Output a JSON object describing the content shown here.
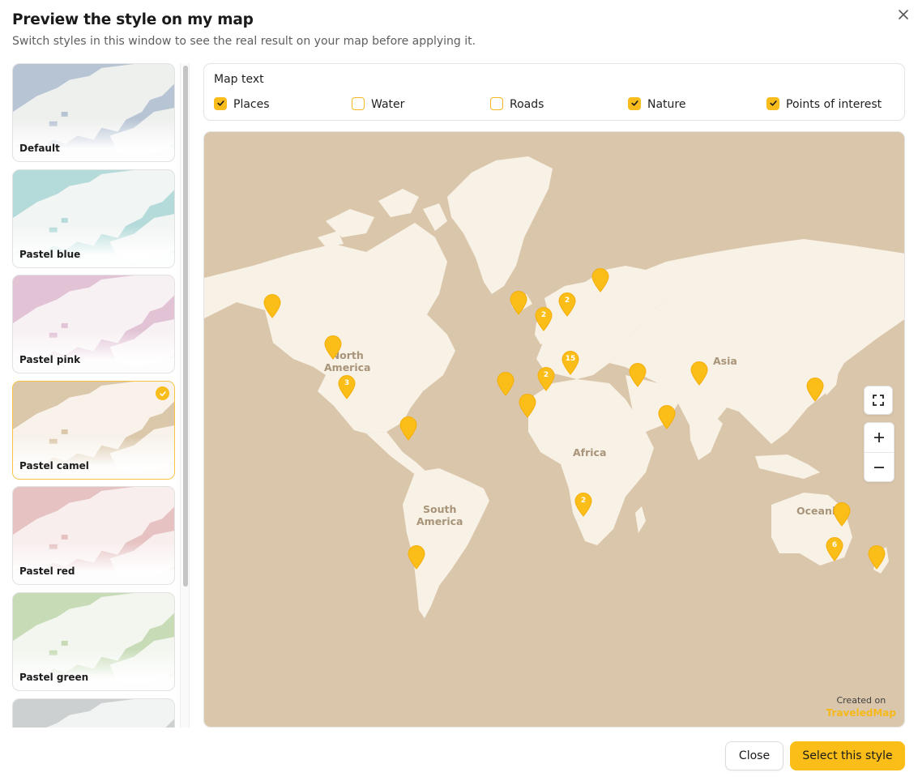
{
  "dialog": {
    "title": "Preview the style on my map",
    "subtitle": "Switch styles in this window to see the real result on your map before applying it.",
    "close_icon": "close-icon"
  },
  "styles": [
    {
      "label": "Default",
      "water": "#b7c4d4",
      "land": "#eef0ee",
      "selected": false
    },
    {
      "label": "Pastel blue",
      "water": "#b4dbd9",
      "land": "#f1f5f3",
      "selected": false
    },
    {
      "label": "Pastel pink",
      "water": "#e2c3d6",
      "land": "#f8f1f4",
      "selected": false
    },
    {
      "label": "Pastel camel",
      "water": "#dbc8ab",
      "land": "#f8f2ea",
      "selected": true
    },
    {
      "label": "Pastel red",
      "water": "#e6c3c2",
      "land": "#f9eeee",
      "selected": false
    },
    {
      "label": "Pastel green",
      "water": "#c6dbb6",
      "land": "#f2f6ee",
      "selected": false
    },
    {
      "label": "",
      "water": "#ccd0d0",
      "land": "#f2f3f3",
      "selected": false
    }
  ],
  "map_text": {
    "title": "Map text",
    "options": [
      {
        "label": "Places",
        "checked": true
      },
      {
        "label": "Water",
        "checked": false
      },
      {
        "label": "Roads",
        "checked": false
      },
      {
        "label": "Nature",
        "checked": true
      },
      {
        "label": "Points of interest",
        "checked": true
      }
    ]
  },
  "map": {
    "water_color": "#dac7ab",
    "land_color": "#f8f1e6",
    "pin_color": "#fbbd17",
    "labels": {
      "north_america": "North\nAmerica",
      "south_america": "South\nAmerica",
      "africa": "Africa",
      "asia": "Asia",
      "oceania": "Oceania"
    },
    "pins": [
      {
        "count": ""
      },
      {
        "count": ""
      },
      {
        "count": "3"
      },
      {
        "count": ""
      },
      {
        "count": "2"
      },
      {
        "count": ""
      },
      {
        "count": "2"
      },
      {
        "count": ""
      },
      {
        "count": ""
      },
      {
        "count": "15"
      },
      {
        "count": "2"
      },
      {
        "count": ""
      },
      {
        "count": ""
      },
      {
        "count": ""
      },
      {
        "count": ""
      },
      {
        "count": ""
      },
      {
        "count": ""
      },
      {
        "count": "2"
      },
      {
        "count": ""
      },
      {
        "count": "6"
      },
      {
        "count": ""
      }
    ],
    "controls": {
      "fullscreen_icon": "fullscreen-icon",
      "zoom_in": "+",
      "zoom_out": "−"
    },
    "credit": {
      "text": "Created on",
      "brand": "TraveledMap"
    }
  },
  "footer": {
    "close_label": "Close",
    "select_label": "Select this style"
  }
}
